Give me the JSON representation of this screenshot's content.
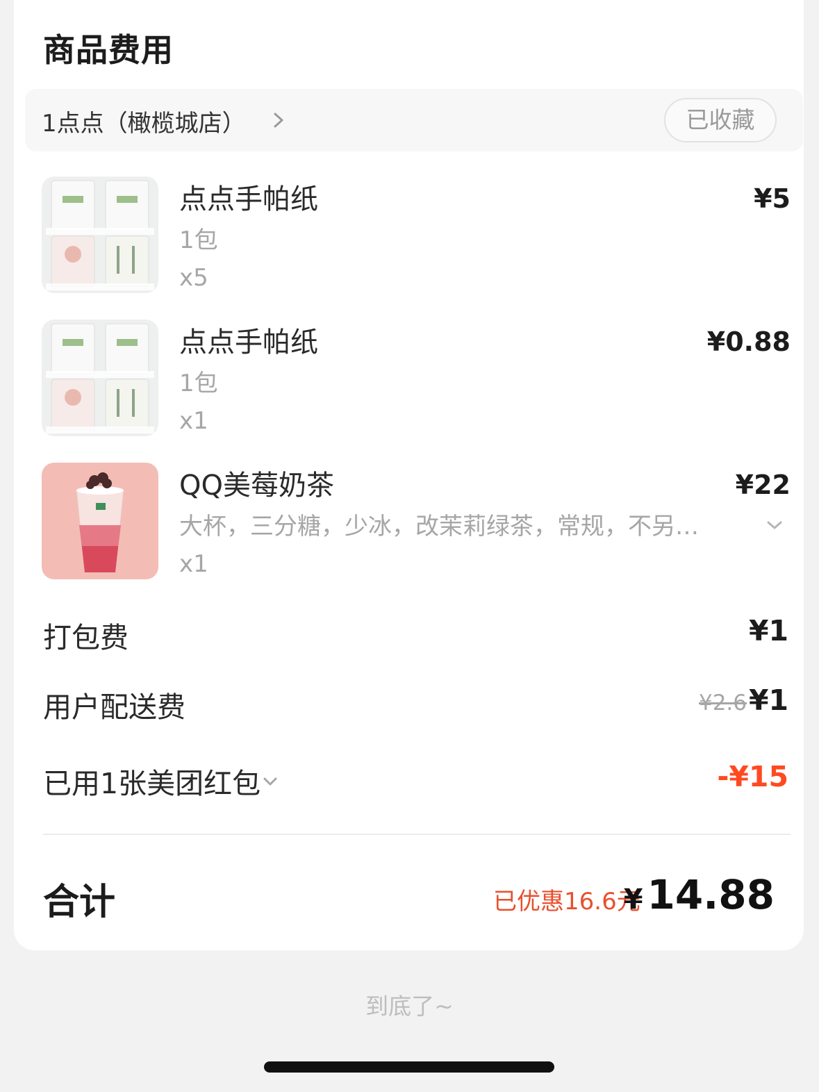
{
  "section_title": "商品费用",
  "store": {
    "name": "1点点（橄榄城店）",
    "favorite_label": "已收藏"
  },
  "items": [
    {
      "name": "点点手帕纸",
      "spec": "1包",
      "qty": "x5",
      "price": "¥5",
      "thumb_icon": "tissue-pack-image"
    },
    {
      "name": "点点手帕纸",
      "spec": "1包",
      "qty": "x1",
      "price": "¥0.88",
      "thumb_icon": "tissue-pack-image"
    },
    {
      "name": "QQ美莓奶茶",
      "spec": "大杯，三分糖，少冰，改茉莉绿茶，常规，不另…",
      "qty": "x1",
      "price": "¥22",
      "thumb_icon": "strawberry-milk-tea-image"
    }
  ],
  "fees": {
    "packaging_label": "打包费",
    "packaging_value": "¥1",
    "delivery_label": "用户配送费",
    "delivery_original": "¥2.6",
    "delivery_value": "¥1",
    "coupon_label": "已用1张美团红包",
    "coupon_value": "-¥15"
  },
  "total": {
    "label": "合计",
    "saved": "已优惠16.6元",
    "currency": "¥",
    "amount": "14.88"
  },
  "footer_text": "到底了~",
  "colors": {
    "accent_red": "#ff4a21",
    "saved_red": "#e8502c",
    "muted_gray": "#a6a6a6"
  }
}
